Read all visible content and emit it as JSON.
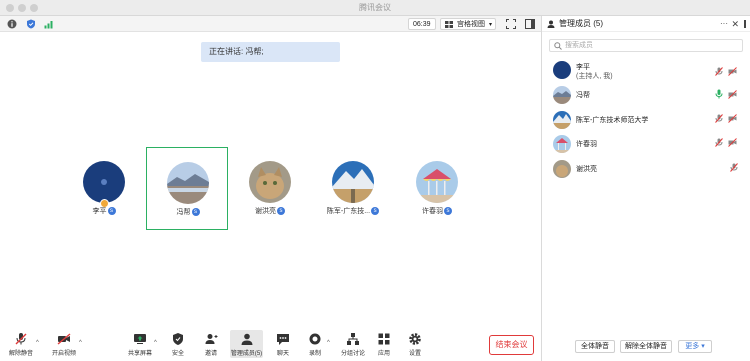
{
  "window": {
    "title": "腾讯会议"
  },
  "topbar": {
    "time": "06:39",
    "view_label": "宫格视图"
  },
  "speaking": {
    "text": "正在讲话: 冯帮;"
  },
  "participants": [
    {
      "name": "李平"
    },
    {
      "name": "冯帮"
    },
    {
      "name": "谢洪亮"
    },
    {
      "name": "陈军-广东技..."
    },
    {
      "name": "许春羽"
    }
  ],
  "toolbar": {
    "unmute": "解除静音",
    "video": "开启视频",
    "share": "共享屏幕",
    "security": "安全",
    "invite": "邀请",
    "members": "管理成员(5)",
    "chat": "聊天",
    "record": "录制",
    "breakout": "分组讨论",
    "apps": "应用",
    "settings": "设置",
    "end": "结束会议"
  },
  "panel": {
    "title": "管理成员 (5)",
    "search_placeholder": "搜索成员",
    "members": [
      {
        "name": "李平",
        "sub": "(主持人, 我)"
      },
      {
        "name": "冯帮",
        "sub": ""
      },
      {
        "name": "陈军-广东技术师范大学",
        "sub": ""
      },
      {
        "name": "许春羽",
        "sub": ""
      },
      {
        "name": "谢洪亮",
        "sub": ""
      }
    ],
    "mute_all": "全体静音",
    "unmute_all": "解除全体静音",
    "more": "更多"
  },
  "colors": {
    "accent": "#3d78d8",
    "active_border": "#2bb062",
    "end_red": "#e03a3a",
    "speaking_bg": "#dae6f7"
  }
}
